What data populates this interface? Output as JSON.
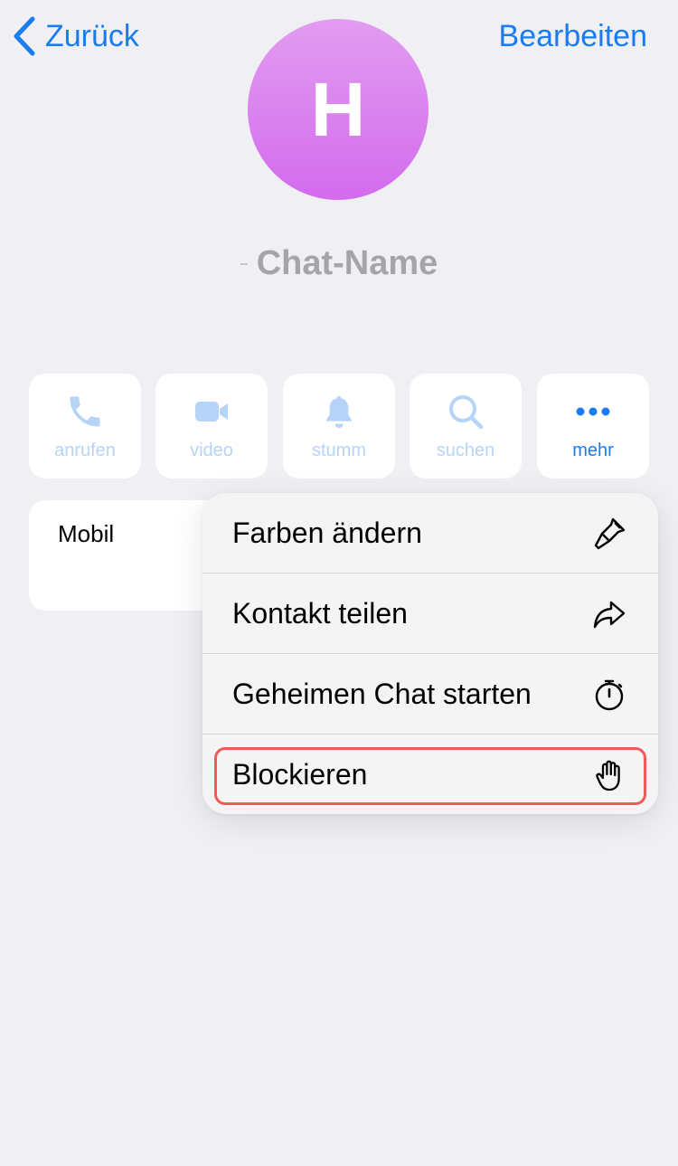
{
  "nav": {
    "back_label": "Zurück",
    "edit_label": "Bearbeiten"
  },
  "profile": {
    "avatar_initial": "H",
    "chat_name": "Chat-Name"
  },
  "actions": [
    {
      "label": "anrufen",
      "icon": "phone-icon"
    },
    {
      "label": "video",
      "icon": "video-icon"
    },
    {
      "label": "stumm",
      "icon": "bell-icon"
    },
    {
      "label": "suchen",
      "icon": "search-icon"
    },
    {
      "label": "mehr",
      "icon": "more-icon"
    }
  ],
  "info": {
    "mobile_label": "Mobil"
  },
  "menu": {
    "items": [
      {
        "label": "Farben ändern",
        "icon": "paintbrush-icon"
      },
      {
        "label": "Kontakt teilen",
        "icon": "share-arrow-icon"
      },
      {
        "label": "Geheimen Chat starten",
        "icon": "timer-icon"
      },
      {
        "label": "Blockieren",
        "icon": "hand-icon"
      }
    ]
  },
  "colors": {
    "accent": "#1a7cf0",
    "accent_disabled": "#b6d4f8",
    "avatar_gradient_top": "#e29cf0",
    "avatar_gradient_bottom": "#d36bee",
    "highlight": "#ee5a55",
    "background": "#efeff4"
  }
}
